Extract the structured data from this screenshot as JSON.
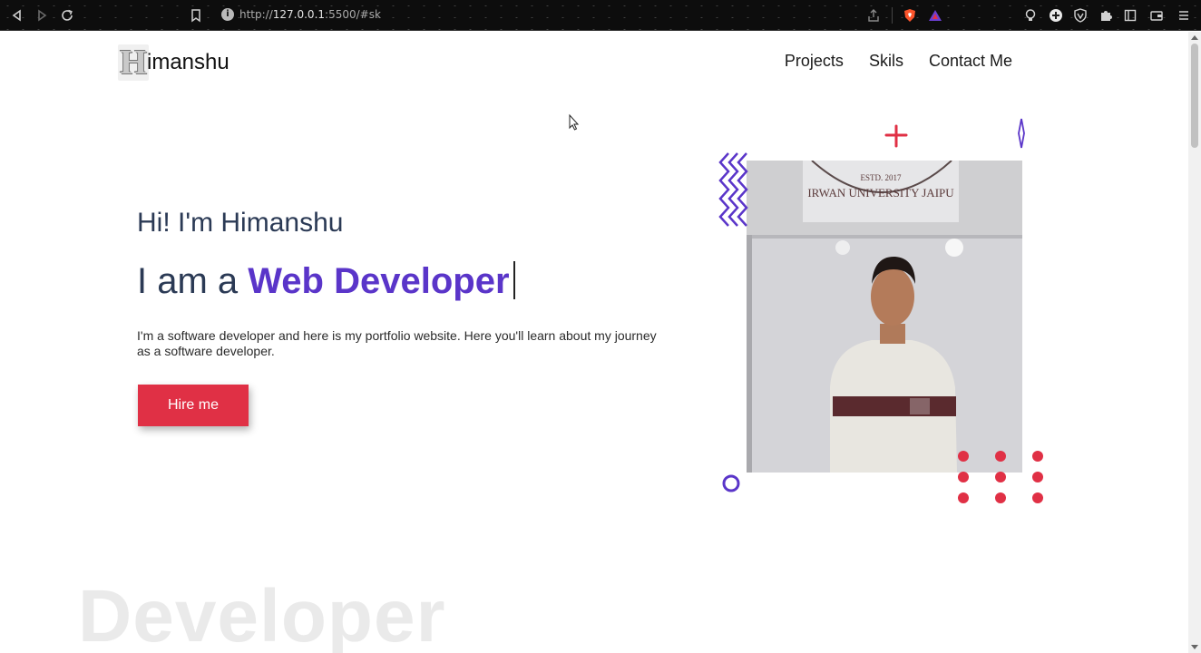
{
  "browser": {
    "url_prefix": "http://",
    "url_host": "127.0.0.1",
    "url_rest": ":5500/#sk",
    "icons": [
      "back-icon",
      "forward-icon",
      "reload-icon",
      "bookmark-icon",
      "info-icon",
      "share-icon",
      "brave-shield-icon",
      "brave-rewards-icon",
      "extension-icons",
      "puzzle-icon",
      "sidebar-icon",
      "wallet-icon",
      "menu-icon"
    ]
  },
  "site": {
    "logo_letter": "H",
    "logo_text": "imanshu",
    "nav": [
      "Projects",
      "Skils",
      "Contact Me"
    ]
  },
  "hero": {
    "greeting": "Hi! I'm Himanshu",
    "role_prefix": "I am a ",
    "role_accent": "Web Developer",
    "description": "I'm a software developer and here is my portfolio website. Here you'll learn about my journey as a software developer.",
    "cta": "Hire me",
    "background_word": "Developer"
  },
  "photo": {
    "banner_text": "IRWAN UNIVERSITY JAIPU",
    "banner_sub": "ESTD. 2017"
  },
  "colors": {
    "accent": "#5a35c9",
    "cta": "#e03045",
    "heading": "#2b3a55",
    "decor_red": "#e03045",
    "decor_purple": "#5a35c9"
  }
}
